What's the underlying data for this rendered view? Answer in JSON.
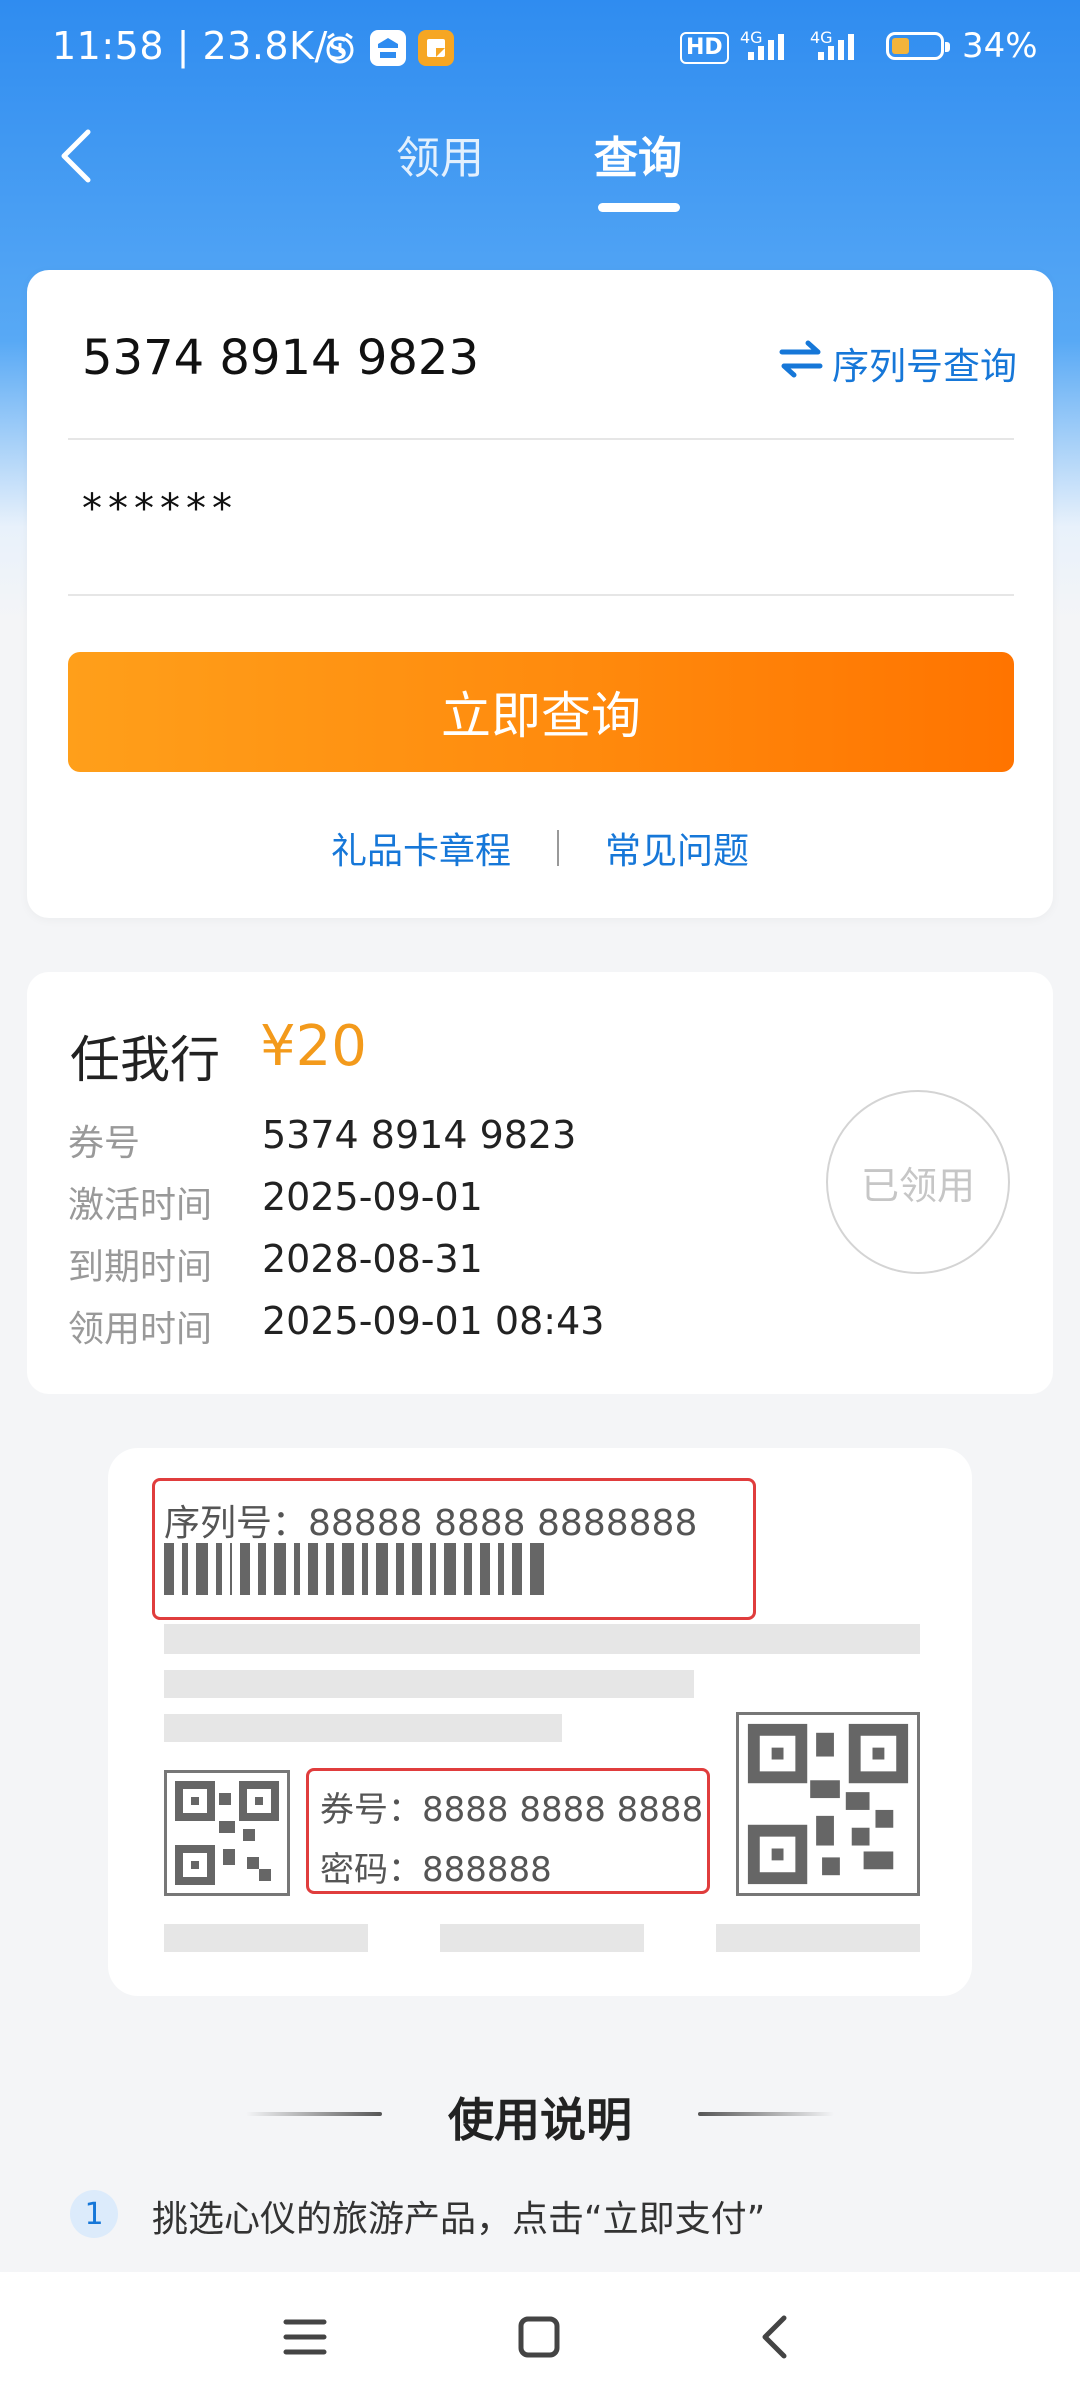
{
  "status_bar": {
    "time": "11:58 | 23.8K/s",
    "battery_pct": "34%",
    "hd": "HD",
    "net1": "4G",
    "net2": "4G",
    "battery_level": 0.34
  },
  "nav": {
    "tabs": [
      "领用",
      "查询"
    ],
    "active_tab": "查询"
  },
  "query_form": {
    "card_number": "5374 8914 9823",
    "password": "******",
    "serial_query_label": "序列号查询",
    "submit_label": "立即查询",
    "links": [
      "礼品卡章程",
      "常见问题"
    ]
  },
  "result": {
    "title": "任我行",
    "price": "¥20",
    "rows": [
      {
        "label": "券号",
        "value": "5374 8914 9823"
      },
      {
        "label": "激活时间",
        "value": "2025-09-01"
      },
      {
        "label": "到期时间",
        "value": "2028-08-31"
      },
      {
        "label": "领用时间",
        "value": "2025-09-01 08:43"
      }
    ],
    "status_badge": "已领用"
  },
  "illustration": {
    "serial_text": "序列号：88888 8888 8888888",
    "card_no_text": "券号：8888 8888 8888",
    "password_text": "密码：888888"
  },
  "usage": {
    "title": "使用说明",
    "steps": [
      {
        "num": "1",
        "text": "挑选心仪的旅游产品，点击“立即支付”"
      }
    ]
  },
  "colors": {
    "brand_blue": "#2f8cf0",
    "link_blue": "#1677d8",
    "orange": "#ff8a0d",
    "price": "#f39a1b",
    "red_outline": "#e03d3d"
  }
}
